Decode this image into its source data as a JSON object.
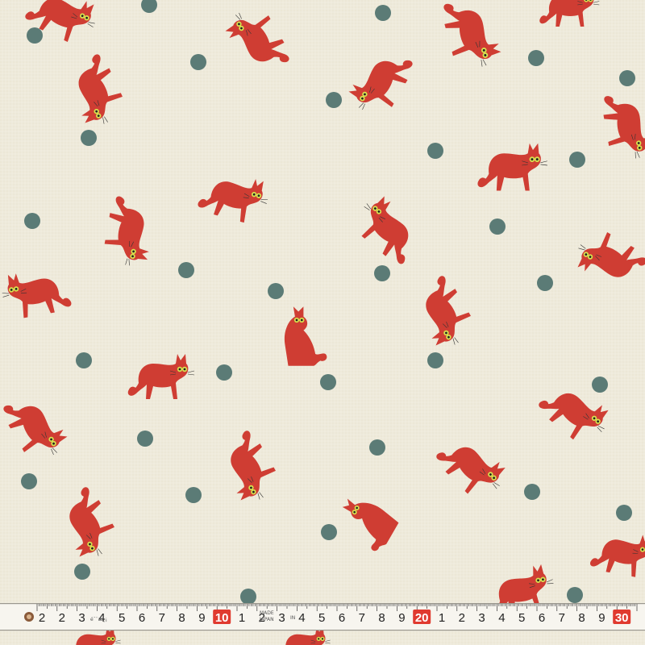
{
  "image": {
    "subject": "cotton-fabric-print-red-cats-and-teal-dots",
    "colors": {
      "background": "#eeeadb",
      "cat": "#cf3d33",
      "cat_dark": "#b8322b",
      "dot": "#5b7b76",
      "eye": "#d7e04f",
      "tape": "#f7f5ef",
      "tape_number_box": "#e03a2f"
    }
  },
  "measuring_tape": {
    "numbers": [
      "2",
      "2",
      "3",
      "4",
      "5",
      "6",
      "7",
      "8",
      "9",
      "10",
      "1",
      "2",
      "3",
      "4",
      "5",
      "6",
      "7",
      "8",
      "9",
      "20",
      "1",
      "2",
      "3",
      "4",
      "5",
      "6",
      "7",
      "8",
      "9",
      "30"
    ],
    "boxed": [
      "10",
      "20",
      "30"
    ],
    "small_labels": [
      "é¯¨æ¸¡",
      "MADE",
      "JAPAN",
      "IN"
    ]
  }
}
